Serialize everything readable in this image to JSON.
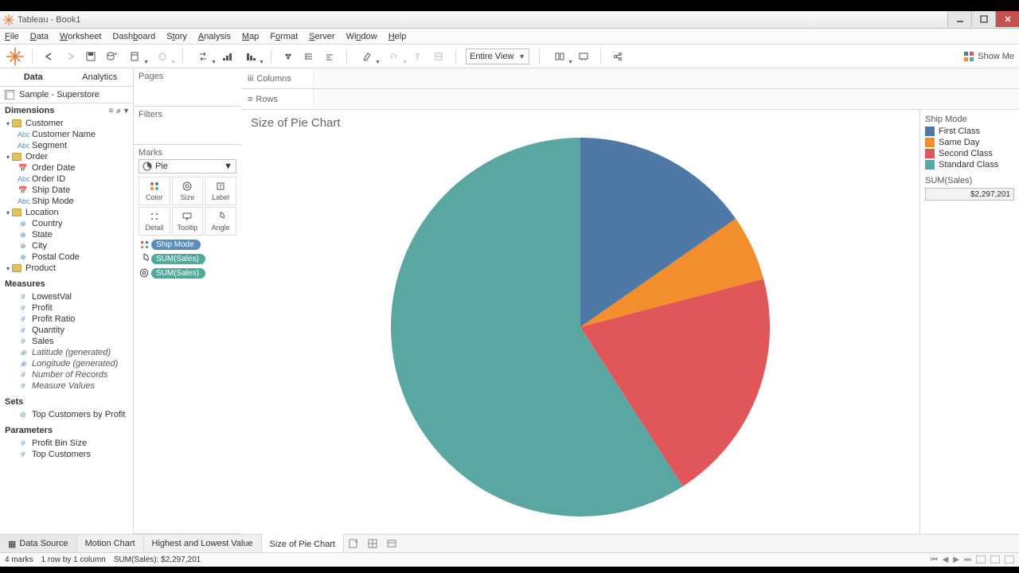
{
  "window": {
    "title": "Tableau - Book1"
  },
  "menu": [
    "File",
    "Data",
    "Worksheet",
    "Dashboard",
    "Story",
    "Analysis",
    "Map",
    "Format",
    "Server",
    "Window",
    "Help"
  ],
  "toolbar": {
    "fit_mode": "Entire View",
    "showme": "Show Me"
  },
  "sidebar": {
    "tabs": {
      "data": "Data",
      "analytics": "Analytics"
    },
    "datasource": "Sample - Superstore",
    "dimensions_label": "Dimensions",
    "dimensions": {
      "groups": [
        {
          "name": "Customer",
          "fields": [
            "Customer Name",
            "Segment"
          ],
          "types": [
            "Abc",
            "Abc"
          ]
        },
        {
          "name": "Order",
          "fields": [
            "Order Date",
            "Order ID",
            "Ship Date",
            "Ship Mode"
          ],
          "types": [
            "date",
            "Abc",
            "date",
            "Abc"
          ]
        },
        {
          "name": "Location",
          "fields": [
            "Country",
            "State",
            "City",
            "Postal Code"
          ],
          "types": [
            "geo",
            "geo",
            "geo",
            "geo"
          ]
        },
        {
          "name": "Product",
          "fields": [],
          "types": []
        }
      ]
    },
    "measures_label": "Measures",
    "measures": [
      "LowestVal",
      "Profit",
      "Profit Ratio",
      "Quantity",
      "Sales"
    ],
    "measures_gen": [
      "Latitude (generated)",
      "Longitude (generated)",
      "Number of Records",
      "Measure Values"
    ],
    "sets_label": "Sets",
    "sets": [
      "Top Customers by Profit"
    ],
    "parameters_label": "Parameters",
    "parameters": [
      "Profit Bin Size",
      "Top Customers"
    ]
  },
  "panels": {
    "pages": "Pages",
    "filters": "Filters",
    "marks": "Marks",
    "mark_type": "Pie",
    "cells": [
      "Color",
      "Size",
      "Label",
      "Detail",
      "Tooltip",
      "Angle"
    ],
    "pills": [
      {
        "icon": "color",
        "label": "Ship Mode",
        "dim": true
      },
      {
        "icon": "angle",
        "label": "SUM(Sales)",
        "dim": false
      },
      {
        "icon": "size",
        "label": "SUM(Sales)",
        "dim": false
      }
    ]
  },
  "shelves": {
    "columns": "Columns",
    "rows": "Rows"
  },
  "viz_title": "Size of Pie Chart",
  "legend": {
    "title": "Ship Mode",
    "items": [
      {
        "label": "First Class",
        "color": "#4e79a7"
      },
      {
        "label": "Same Day",
        "color": "#f28e2b"
      },
      {
        "label": "Second Class",
        "color": "#e15759"
      },
      {
        "label": "Standard Class",
        "color": "#59a7a0"
      }
    ],
    "size_title": "SUM(Sales)",
    "size_value": "$2,297,201"
  },
  "sheet_tabs": {
    "datasource": "Data Source",
    "tabs": [
      "Motion Chart",
      "Highest and Lowest Value",
      "Size of Pie Chart"
    ],
    "active": 2
  },
  "status": {
    "marks": "4 marks",
    "rowcol": "1 row by 1 column",
    "sum": "SUM(Sales): $2,297,201"
  },
  "chart_data": {
    "type": "pie",
    "title": "Size of Pie Chart",
    "series_name": "Ship Mode",
    "value_name": "SUM(Sales)",
    "total": 2297201,
    "slices": [
      {
        "label": "First Class",
        "value": 351428,
        "percent": 15.3,
        "color": "#4e79a7"
      },
      {
        "label": "Same Day",
        "value": 128363,
        "percent": 5.6,
        "color": "#f28e2b"
      },
      {
        "label": "Second Class",
        "value": 459194,
        "percent": 20.0,
        "color": "#e15759"
      },
      {
        "label": "Standard Class",
        "value": 1358216,
        "percent": 59.1,
        "color": "#59a7a0"
      }
    ]
  }
}
